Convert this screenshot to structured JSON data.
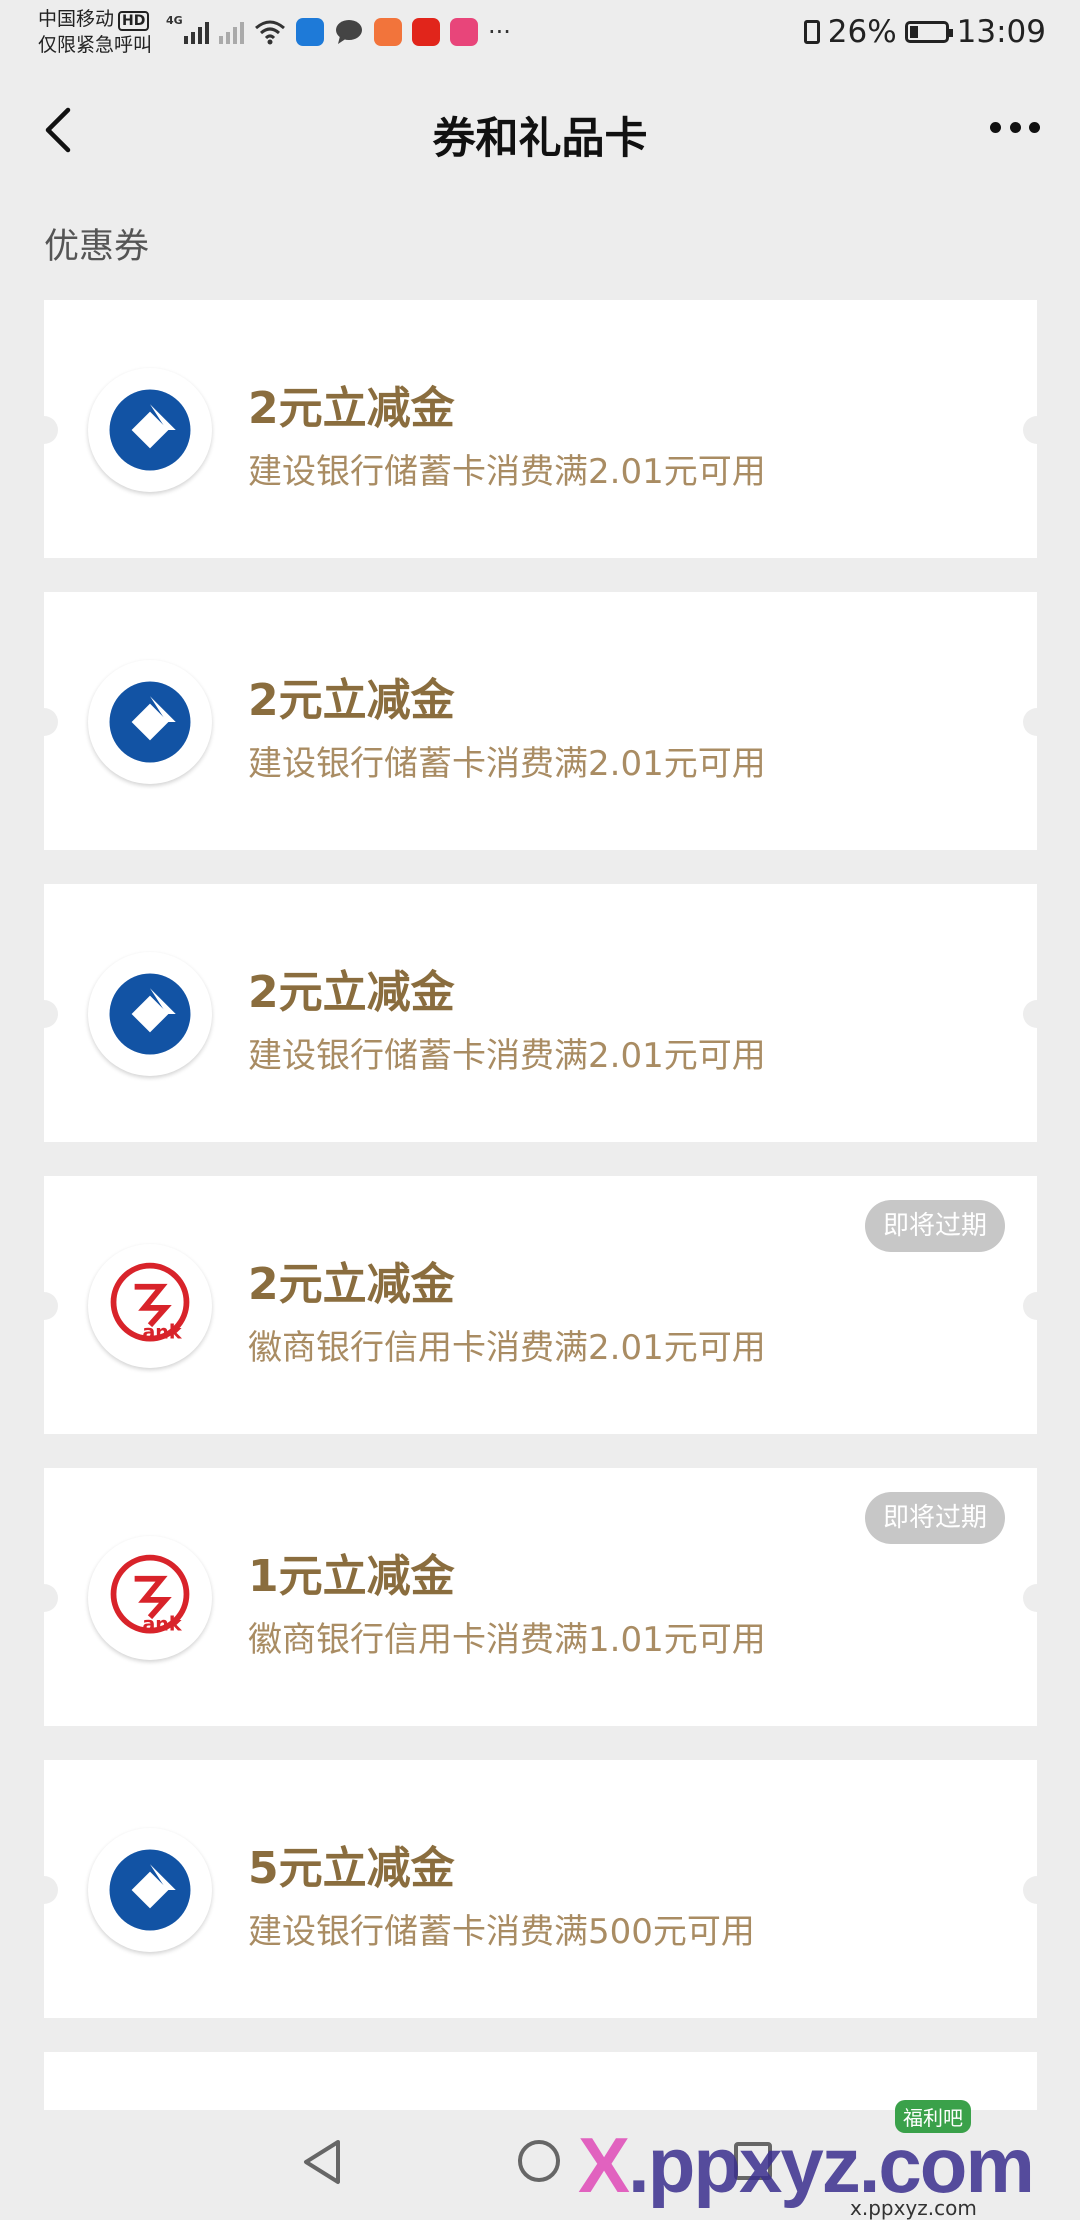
{
  "status_bar": {
    "carrier": "中国移动",
    "hd": "HD",
    "emergency": "仅限紧急呼叫",
    "network": "4G",
    "battery": "26%",
    "battery_level": 0.26,
    "time": "13:09",
    "more": "···"
  },
  "header": {
    "title": "券和礼品卡"
  },
  "section": {
    "label": "优惠券"
  },
  "coupons": [
    {
      "bank": "ccb",
      "title": "2元立减金",
      "desc": "建设银行储蓄卡消费满2.01元可用",
      "badge": ""
    },
    {
      "bank": "ccb",
      "title": "2元立减金",
      "desc": "建设银行储蓄卡消费满2.01元可用",
      "badge": ""
    },
    {
      "bank": "ccb",
      "title": "2元立减金",
      "desc": "建设银行储蓄卡消费满2.01元可用",
      "badge": ""
    },
    {
      "bank": "hsb",
      "title": "2元立减金",
      "desc": "徽商银行信用卡消费满2.01元可用",
      "badge": "即将过期"
    },
    {
      "bank": "hsb",
      "title": "1元立减金",
      "desc": "徽商银行信用卡消费满1.01元可用",
      "badge": "即将过期"
    },
    {
      "bank": "ccb",
      "title": "5元立减金",
      "desc": "建设银行储蓄卡消费满500元可用",
      "badge": ""
    }
  ],
  "logos": {
    "hsb_text": "ank"
  },
  "watermark": {
    "x": "X",
    "rest": ".ppxyz.com",
    "sub": "x.ppxyz.com",
    "badge": "福利吧"
  },
  "colors": {
    "coupon_title": "#8a6d3e",
    "coupon_desc": "#a98c63",
    "ccb_blue": "#1253a4",
    "hsb_red": "#d8232a",
    "badge_bg": "#c7c7c7"
  }
}
